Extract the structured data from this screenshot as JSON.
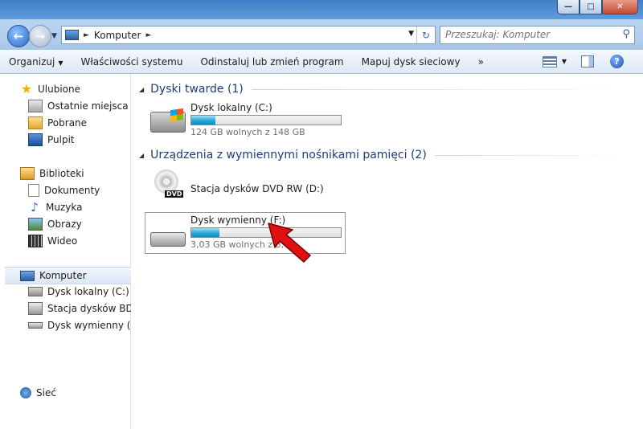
{
  "window": {
    "minimize_glyph": "—",
    "maximize_glyph": "□",
    "close_glyph": "✕"
  },
  "address": {
    "crumb": "Komputer",
    "search_placeholder": "Przeszukaj: Komputer"
  },
  "toolbar": {
    "organize": "Organizuj",
    "system_props": "Właściwości systemu",
    "uninstall": "Odinstaluj lub zmień program",
    "map_drive": "Mapuj dysk sieciowy",
    "more": "»",
    "help": "?"
  },
  "sidebar": {
    "favorites": "Ulubione",
    "recent": "Ostatnie miejsca",
    "downloads": "Pobrane",
    "desktop": "Pulpit",
    "libraries": "Biblioteki",
    "documents": "Dokumenty",
    "music": "Muzyka",
    "pictures": "Obrazy",
    "videos": "Wideo",
    "computer": "Komputer",
    "local_disk": "Dysk lokalny (C:)",
    "bd_drive": "Stacja dysków BD-R",
    "removable": "Dysk wymienny (F:)",
    "network": "Sieć"
  },
  "groups": {
    "hard_disks": "Dyski twarde (1)",
    "removable": "Urządzenia z wymiennymi nośnikami pamięci (2)"
  },
  "drives": {
    "c": {
      "name": "Dysk lokalny (C:)",
      "free": "124 GB wolnych z 148 GB",
      "used_fraction": 0.16
    },
    "d": {
      "name": "Stacja dysków DVD RW (D:)",
      "label": "DVD"
    },
    "f": {
      "name": "Dysk wymienny (F:)",
      "free": "3,03 GB wolnych z 3,",
      "used_fraction": 0.19
    }
  },
  "colors": {
    "annotation_arrow": "#e01010",
    "usage_bar": "#27a7d8"
  }
}
